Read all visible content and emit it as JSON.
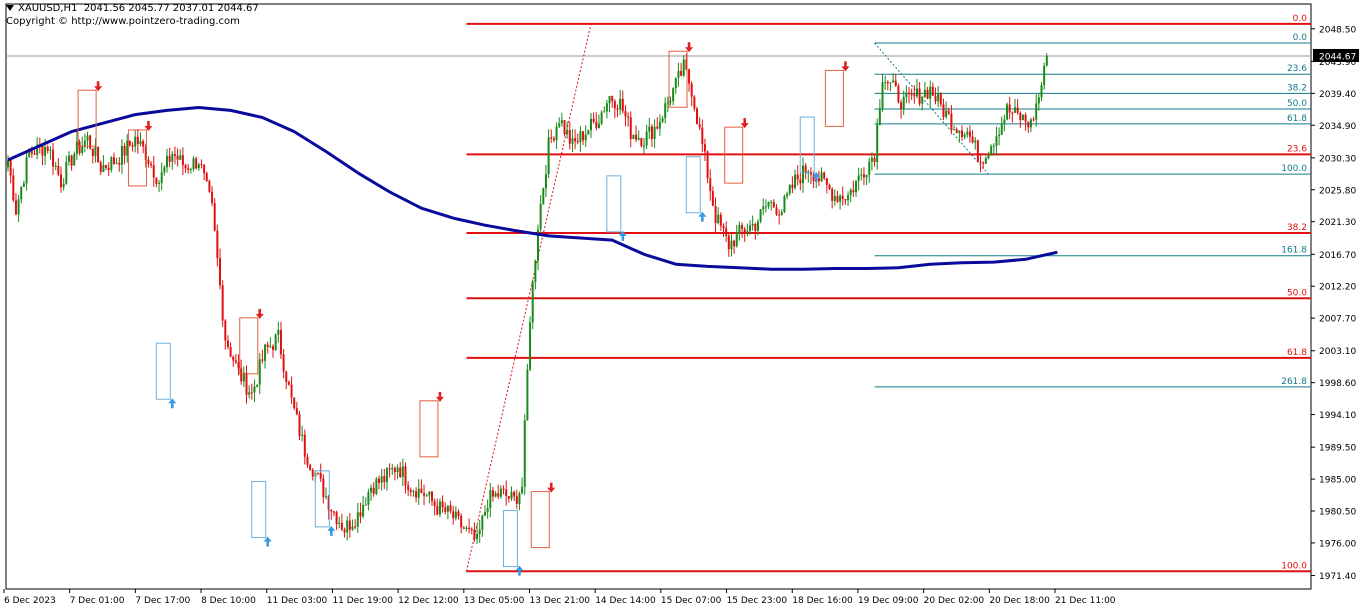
{
  "header": {
    "symbol": "XAUUSD,H1",
    "ohlc": "2041.56 2045.77 2037.01 2044.67",
    "copyright": "Copyright © http://www.pointzero-trading.com"
  },
  "colors": {
    "bull": "#1a8a1a",
    "bear": "#e01010",
    "ma": "#0a0a9c",
    "fibo_red": "#e01010",
    "fibo_teal": "#137a8a",
    "box_red": "#e06040",
    "box_blue": "#6ab0e0",
    "arrow_up": "#3a9ae0",
    "arrow_down": "#e02020"
  },
  "chart_data": {
    "type": "candlestick",
    "symbol": "XAUUSD",
    "timeframe": "H1",
    "last_price": 2044.67,
    "current_price_label": "2044.67",
    "ylim": [
      1969.5,
      2052.0
    ],
    "y_ticks": [
      "2048.50",
      "2043.90",
      "2039.40",
      "2034.90",
      "2030.30",
      "2025.80",
      "2021.30",
      "2016.70",
      "2012.20",
      "2007.70",
      "2003.10",
      "1998.60",
      "1994.10",
      "1989.50",
      "1985.00",
      "1980.50",
      "1976.00",
      "1971.40"
    ],
    "x_labels": [
      "6 Dec 2023",
      "7 Dec 01:00",
      "7 Dec 17:00",
      "8 Dec 10:00",
      "11 Dec 03:00",
      "11 Dec 19:00",
      "12 Dec 12:00",
      "13 Dec 05:00",
      "13 Dec 21:00",
      "14 Dec 14:00",
      "15 Dec 07:00",
      "15 Dec 23:00",
      "18 Dec 16:00",
      "19 Dec 09:00",
      "20 Dec 02:00",
      "20 Dec 18:00",
      "21 Dec 11:00"
    ],
    "anchors": [
      [
        0,
        2030
      ],
      [
        3,
        2023
      ],
      [
        8,
        2031
      ],
      [
        15,
        2032
      ],
      [
        20,
        2027
      ],
      [
        25,
        2031
      ],
      [
        30,
        2033
      ],
      [
        35,
        2029
      ],
      [
        41,
        2030
      ],
      [
        48,
        2033
      ],
      [
        52,
        2031
      ],
      [
        57,
        2027
      ],
      [
        62,
        2031
      ],
      [
        67,
        2029
      ],
      [
        72,
        2030
      ],
      [
        77,
        2023
      ],
      [
        82,
        2005
      ],
      [
        87,
        2000
      ],
      [
        92,
        1997
      ],
      [
        97,
        2003
      ],
      [
        102,
        2005
      ],
      [
        107,
        1996
      ],
      [
        112,
        1989
      ],
      [
        117,
        1985
      ],
      [
        122,
        1981
      ],
      [
        127,
        1978
      ],
      [
        132,
        1980
      ],
      [
        137,
        1984
      ],
      [
        142,
        1985
      ],
      [
        147,
        1987
      ],
      [
        152,
        1984
      ],
      [
        157,
        1983
      ],
      [
        162,
        1981
      ],
      [
        167,
        1980
      ],
      [
        172,
        1978
      ],
      [
        177,
        1976
      ],
      [
        181,
        1982
      ],
      [
        186,
        1983
      ],
      [
        191,
        1982
      ],
      [
        194,
        1984
      ],
      [
        197,
        2008
      ],
      [
        200,
        2021
      ],
      [
        204,
        2032
      ],
      [
        208,
        2036
      ],
      [
        213,
        2032
      ],
      [
        218,
        2034
      ],
      [
        223,
        2036
      ],
      [
        227,
        2039
      ],
      [
        231,
        2038
      ],
      [
        235,
        2034
      ],
      [
        240,
        2033
      ],
      [
        245,
        2035
      ],
      [
        250,
        2039
      ],
      [
        255,
        2043
      ],
      [
        258,
        2040
      ],
      [
        263,
        2030
      ],
      [
        267,
        2022
      ],
      [
        272,
        2018
      ],
      [
        277,
        2020
      ],
      [
        282,
        2021
      ],
      [
        287,
        2024
      ],
      [
        292,
        2023
      ],
      [
        297,
        2027
      ],
      [
        302,
        2029
      ],
      [
        307,
        2027
      ],
      [
        312,
        2025
      ],
      [
        317,
        2025
      ],
      [
        322,
        2028
      ],
      [
        327,
        2031
      ],
      [
        330,
        2042
      ],
      [
        334,
        2040
      ],
      [
        338,
        2038
      ],
      [
        343,
        2039
      ],
      [
        348,
        2040
      ],
      [
        353,
        2037
      ],
      [
        357,
        2035
      ],
      [
        362,
        2034
      ],
      [
        367,
        2030
      ],
      [
        372,
        2033
      ],
      [
        377,
        2037
      ],
      [
        382,
        2036
      ],
      [
        386,
        2035
      ],
      [
        389,
        2039
      ],
      [
        392,
        2044
      ]
    ],
    "moving_average": [
      [
        0,
        2030.0
      ],
      [
        12,
        2032.0
      ],
      [
        24,
        2034.0
      ],
      [
        36,
        2035.2
      ],
      [
        48,
        2036.4
      ],
      [
        60,
        2037.0
      ],
      [
        72,
        2037.4
      ],
      [
        84,
        2037.0
      ],
      [
        96,
        2036.0
      ],
      [
        108,
        2034.0
      ],
      [
        120,
        2031.2
      ],
      [
        132,
        2028.2
      ],
      [
        144,
        2025.5
      ],
      [
        156,
        2023.2
      ],
      [
        168,
        2021.8
      ],
      [
        180,
        2020.8
      ],
      [
        192,
        2020.0
      ],
      [
        204,
        2019.3
      ],
      [
        216,
        2019.0
      ],
      [
        228,
        2018.7
      ],
      [
        240,
        2016.7
      ],
      [
        252,
        2015.3
      ],
      [
        264,
        2015.0
      ],
      [
        276,
        2014.8
      ],
      [
        288,
        2014.6
      ],
      [
        300,
        2014.6
      ],
      [
        312,
        2014.7
      ],
      [
        324,
        2014.7
      ],
      [
        336,
        2014.8
      ],
      [
        348,
        2015.3
      ],
      [
        360,
        2015.5
      ],
      [
        372,
        2015.6
      ],
      [
        384,
        2016.0
      ],
      [
        396,
        2017.0
      ]
    ],
    "fibonacci_large": {
      "high": 2049.2,
      "low": 1972.0,
      "levels": [
        {
          "label": "0.0",
          "price": 2049.2
        },
        {
          "label": "23.6",
          "price": 2030.8
        },
        {
          "label": "38.2",
          "price": 2019.7
        },
        {
          "label": "50.0",
          "price": 2010.5
        },
        {
          "label": "61.8",
          "price": 2002.1
        },
        {
          "label": "100.0",
          "price": 1972.0
        }
      ]
    },
    "fibonacci_small": {
      "high": 2046.5,
      "low": 2028.0,
      "levels": [
        {
          "label": "0.0",
          "price": 2046.5
        },
        {
          "label": "23.6",
          "price": 2042.1
        },
        {
          "label": "38.2",
          "price": 2039.4
        },
        {
          "label": "50.0",
          "price": 2037.2
        },
        {
          "label": "61.8",
          "price": 2035.1
        },
        {
          "label": "100.0",
          "price": 2028.0
        },
        {
          "label": "161.8",
          "price": 2016.5
        },
        {
          "label": "261.8",
          "price": 1998.0
        }
      ]
    },
    "up_arrows": [
      [
        62,
        1995.7
      ],
      [
        98,
        1976.2
      ],
      [
        122,
        1977.7
      ],
      [
        193,
        1972.1
      ],
      [
        232,
        2019.3
      ],
      [
        262,
        2022.0
      ],
      [
        305,
        2027.6
      ]
    ],
    "down_arrows": [
      [
        34,
        2040.4
      ],
      [
        53,
        2034.8
      ],
      [
        95,
        2008.3
      ],
      [
        163,
        1996.6
      ],
      [
        205,
        1983.8
      ],
      [
        257,
        2045.9
      ],
      [
        278,
        2035.2
      ],
      [
        316,
        2043.2
      ]
    ]
  }
}
